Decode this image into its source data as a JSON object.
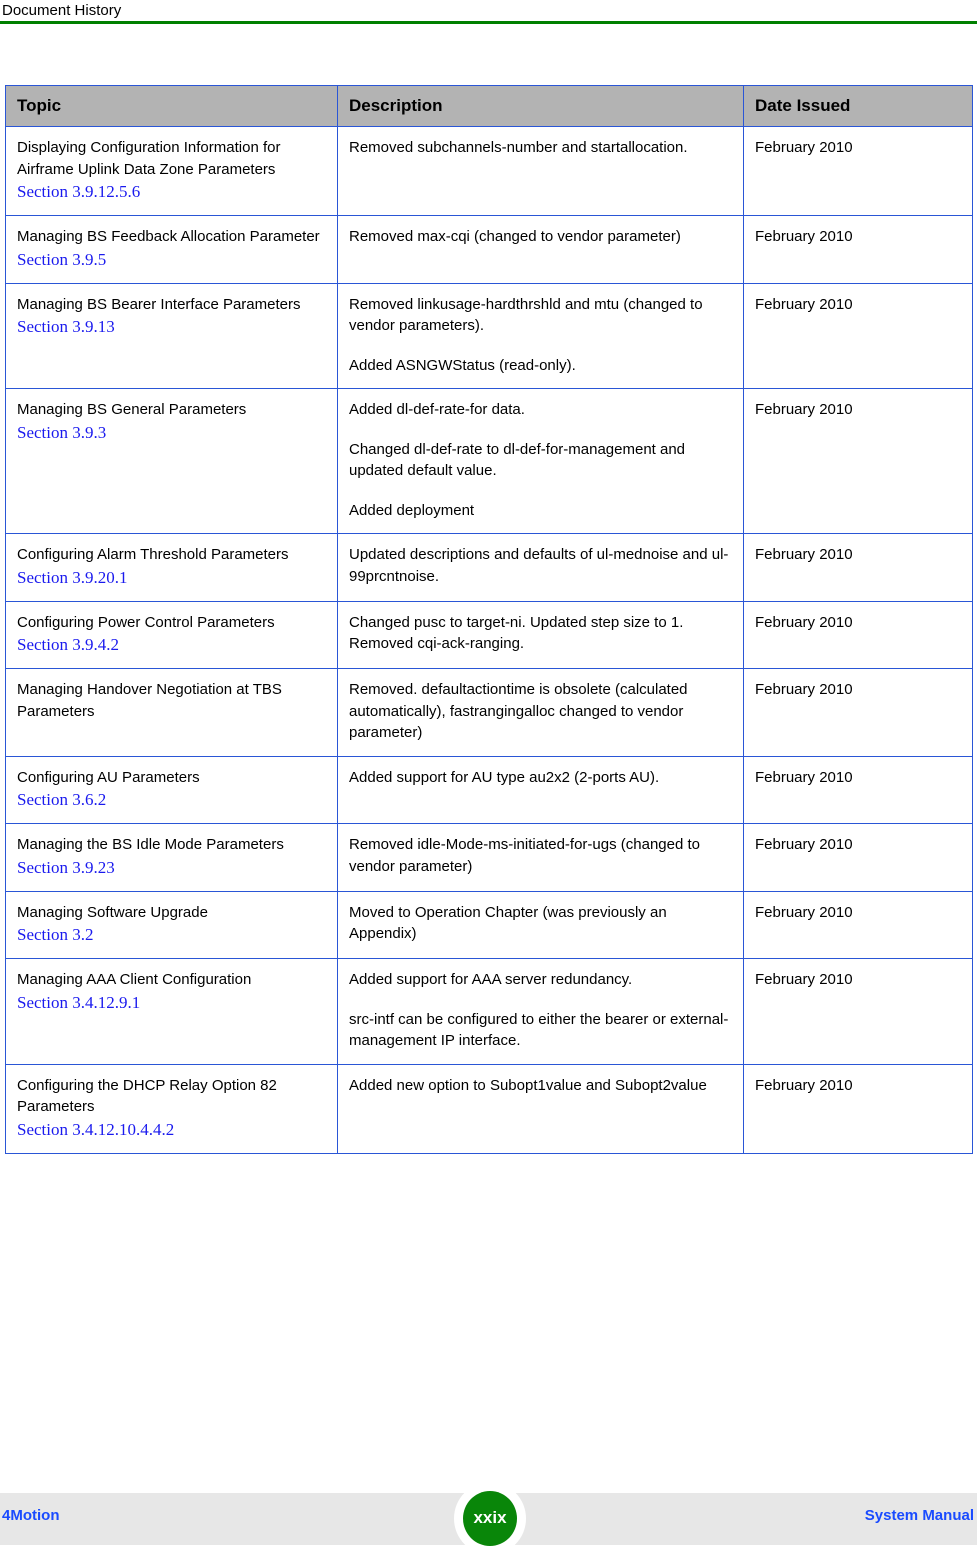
{
  "header": {
    "title": "Document History",
    "rule_color": "#008000"
  },
  "table": {
    "columns": [
      "Topic",
      "Description",
      "Date Issued"
    ],
    "header_bg": "#b3b3b3",
    "border_color": "#2a56d6",
    "link_color": "#1a1aee",
    "rows": [
      {
        "topic": "Displaying Configuration Information for Airframe Uplink Data Zone Parameters",
        "section": "Section 3.9.12.5.6",
        "description": [
          "Removed subchannels-number and startallocation."
        ],
        "date": "February 2010"
      },
      {
        "topic": "Managing BS Feedback Allocation Parameter",
        "section": "Section 3.9.5",
        "description": [
          "Removed max-cqi (changed to vendor parameter)"
        ],
        "date": "February 2010"
      },
      {
        "topic": "Managing BS Bearer Interface Parameters",
        "section": "Section 3.9.13",
        "description": [
          "Removed linkusage-hardthrshld and mtu (changed to vendor parameters).",
          "Added ASNGWStatus (read-only)."
        ],
        "date": "February 2010"
      },
      {
        "topic": "Managing BS General Parameters",
        "section": "Section 3.9.3",
        "description": [
          "Added dl-def-rate-for data.",
          "Changed dl-def-rate to dl-def-for-management and updated default value.",
          "Added deployment"
        ],
        "date": "February 2010"
      },
      {
        "topic": "Configuring Alarm Threshold Parameters",
        "section": "Section 3.9.20.1",
        "description": [
          "Updated descriptions and defaults of ul-mednoise and ul-99prcntnoise."
        ],
        "date": "February 2010"
      },
      {
        "topic": "Configuring Power Control Parameters",
        "section": "Section 3.9.4.2",
        "description": [
          "Changed pusc to target-ni. Updated step size to 1. Removed cqi-ack-ranging."
        ],
        "date": "February 2010"
      },
      {
        "topic": "Managing Handover Negotiation at TBS Parameters",
        "section": "",
        "description": [
          "Removed. defaultactiontime is obsolete (calculated automatically), fastrangingalloc changed to vendor parameter)"
        ],
        "date": "February 2010"
      },
      {
        "topic": "Configuring AU Parameters",
        "section": "Section 3.6.2",
        "description": [
          "Added support for AU type au2x2 (2-ports AU)."
        ],
        "date": "February 2010"
      },
      {
        "topic": "Managing the BS Idle Mode Parameters",
        "section": "Section 3.9.23",
        "description": [
          "Removed idle-Mode-ms-initiated-for-ugs (changed to vendor parameter)"
        ],
        "date": "February 2010"
      },
      {
        "topic": "Managing Software Upgrade",
        "section": "Section 3.2",
        "description": [
          "Moved to Operation Chapter (was previously an Appendix)"
        ],
        "date": "February 2010"
      },
      {
        "topic": "Managing AAA Client Configuration",
        "section": "Section 3.4.12.9.1",
        "description": [
          "Added support for AAA server redundancy.",
          "src-intf can be configured to either the bearer or external-management IP interface."
        ],
        "date": "February 2010"
      },
      {
        "topic": "Configuring the DHCP Relay Option 82 Parameters",
        "section": "Section 3.4.12.10.4.4.2",
        "description": [
          "Added new option to Subopt1value and Subopt2value"
        ],
        "date": "February 2010"
      }
    ]
  },
  "footer": {
    "left": "4Motion",
    "right": "System Manual",
    "page_number": "xxix",
    "badge_color": "#098609",
    "band_color": "#e7e7e7"
  }
}
